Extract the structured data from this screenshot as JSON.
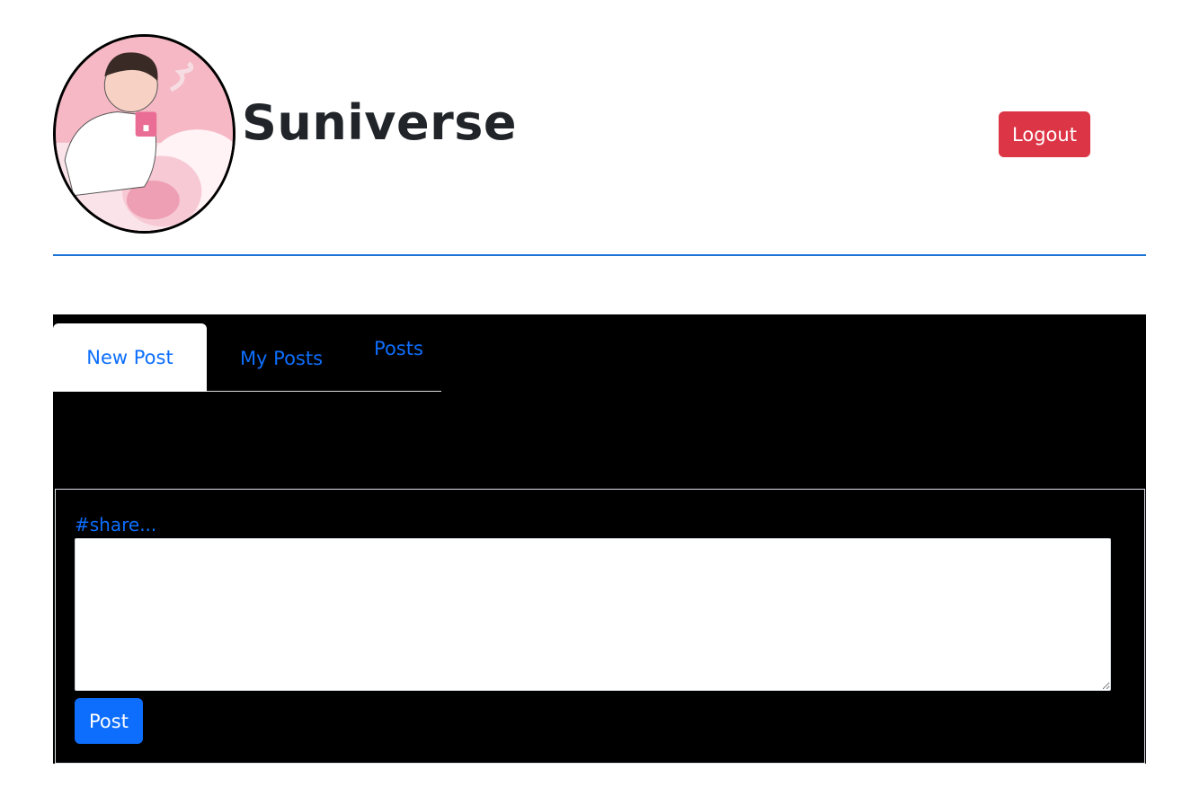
{
  "header": {
    "title": "Suniverse",
    "logout_label": "Logout",
    "avatar_icon": "profile-avatar"
  },
  "tabs": [
    {
      "label": "New Post",
      "active": true
    },
    {
      "label": "My Posts",
      "active": false
    },
    {
      "label": "Posts",
      "active": false
    }
  ],
  "new_post": {
    "label": "#share...",
    "textarea_value": "",
    "post_label": "Post"
  },
  "colors": {
    "accent": "#0d6efd",
    "danger": "#dc3545",
    "divider": "#1a73d9",
    "panel_bg": "#000000"
  }
}
